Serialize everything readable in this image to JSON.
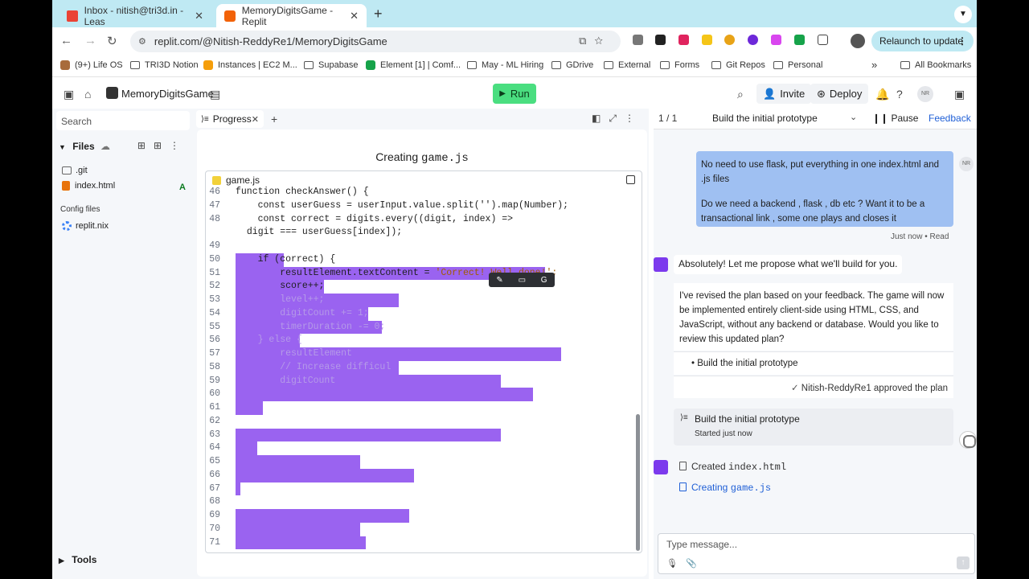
{
  "browser": {
    "tabs": [
      {
        "label": "Inbox - nitish@tri3d.in - Leas",
        "active": false
      },
      {
        "label": "MemoryDigitsGame - Replit",
        "active": true
      }
    ],
    "url": "replit.com/@Nitish-ReddyRe1/MemoryDigitsGame",
    "relaunch_label": "Relaunch to update",
    "bookmarks": [
      "(9+) Life OS",
      "TRI3D Notion",
      "Instances | EC2 M...",
      "Supabase",
      "Element [1] | Comf...",
      "May - ML Hiring",
      "GDrive",
      "External",
      "Forms",
      "Git Repos",
      "Personal"
    ],
    "all_bookmarks": "All Bookmarks",
    "more_bookmarks": "»"
  },
  "header": {
    "repl_name": "MemoryDigitsGame",
    "run_label": "Run",
    "invite_label": "Invite",
    "deploy_label": "Deploy",
    "help": "?",
    "avatar_initials": "NR"
  },
  "sidebar": {
    "search_placeholder": "Search",
    "files_label": "Files",
    "files": [
      {
        "name": ".git",
        "type": "folder"
      },
      {
        "name": "index.html",
        "type": "html",
        "badge": "A"
      }
    ],
    "config_label": "Config files",
    "config_files": [
      {
        "name": "replit.nix"
      }
    ],
    "tools_label": "Tools"
  },
  "editor": {
    "tab_label": "Progress",
    "creating_prefix": "Creating",
    "creating_file": "game.js",
    "code_file": "game.js",
    "lines": [
      {
        "n": "46",
        "text": "function checkAnswer() {"
      },
      {
        "n": "47",
        "text": "    const userGuess = userInput.value.split('').map(Number);"
      },
      {
        "n": "48",
        "text": "    const correct = digits.every((digit, index) =>"
      },
      {
        "n": "",
        "text": " digit === userGuess[index]);"
      },
      {
        "n": "49",
        "text": ""
      },
      {
        "n": "50",
        "text": "    if (correct) {"
      },
      {
        "n": "51",
        "text": "        resultElement.textContent = 'Correct! Well done!';"
      },
      {
        "n": "52",
        "text": "        score++;"
      },
      {
        "n": "53",
        "text": "        level++;"
      },
      {
        "n": "54",
        "text": "        digitCount += 1;"
      },
      {
        "n": "55",
        "text": "        timerDuration -= 0;"
      },
      {
        "n": "56",
        "text": "    } else {"
      },
      {
        "n": "57",
        "text": "        resultElement"
      },
      {
        "n": "58",
        "text": "        // Increase difficul"
      },
      {
        "n": "59",
        "text": "        digitCount"
      },
      {
        "n": "60",
        "text": ""
      },
      {
        "n": "61",
        "text": ""
      },
      {
        "n": "62",
        "text": ""
      },
      {
        "n": "63",
        "text": ""
      },
      {
        "n": "64",
        "text": ""
      },
      {
        "n": "65",
        "text": ""
      },
      {
        "n": "66",
        "text": ""
      },
      {
        "n": "67",
        "text": ""
      },
      {
        "n": "68",
        "text": ""
      },
      {
        "n": "69",
        "text": ""
      },
      {
        "n": "70",
        "text": ""
      },
      {
        "n": "71",
        "text": ""
      }
    ]
  },
  "chat": {
    "plan_count": "1 / 1",
    "plan_title": "Build the initial prototype",
    "pause_label": "Pause",
    "feedback_label": "Feedback",
    "user_message_1": "No need to use flask, put everything in one index.html and .js files",
    "user_message_2": "Do we need a backend , flask , db etc ? Want it to be a transactional link , some one plays and closes it",
    "user_avatar": "NR",
    "meta": "Just now • Read",
    "agent_message": "Absolutely! Let me propose what we'll build for you.",
    "revised_plan": "I've revised the plan based on your feedback. The game will now be implemented entirely client-side using HTML, CSS, and JavaScript, without any backend or database. Would you like to review this updated plan?",
    "plan_item": "Build the initial prototype",
    "approved_text": "Nitish-ReddyRe1 approved the plan",
    "build_title": "Build the initial prototype",
    "build_status": "Started just now",
    "created_prefix": "Created",
    "created_file": "index.html",
    "creating_prefix": "Creating",
    "creating_file": "game.js",
    "input_placeholder": "Type message..."
  }
}
